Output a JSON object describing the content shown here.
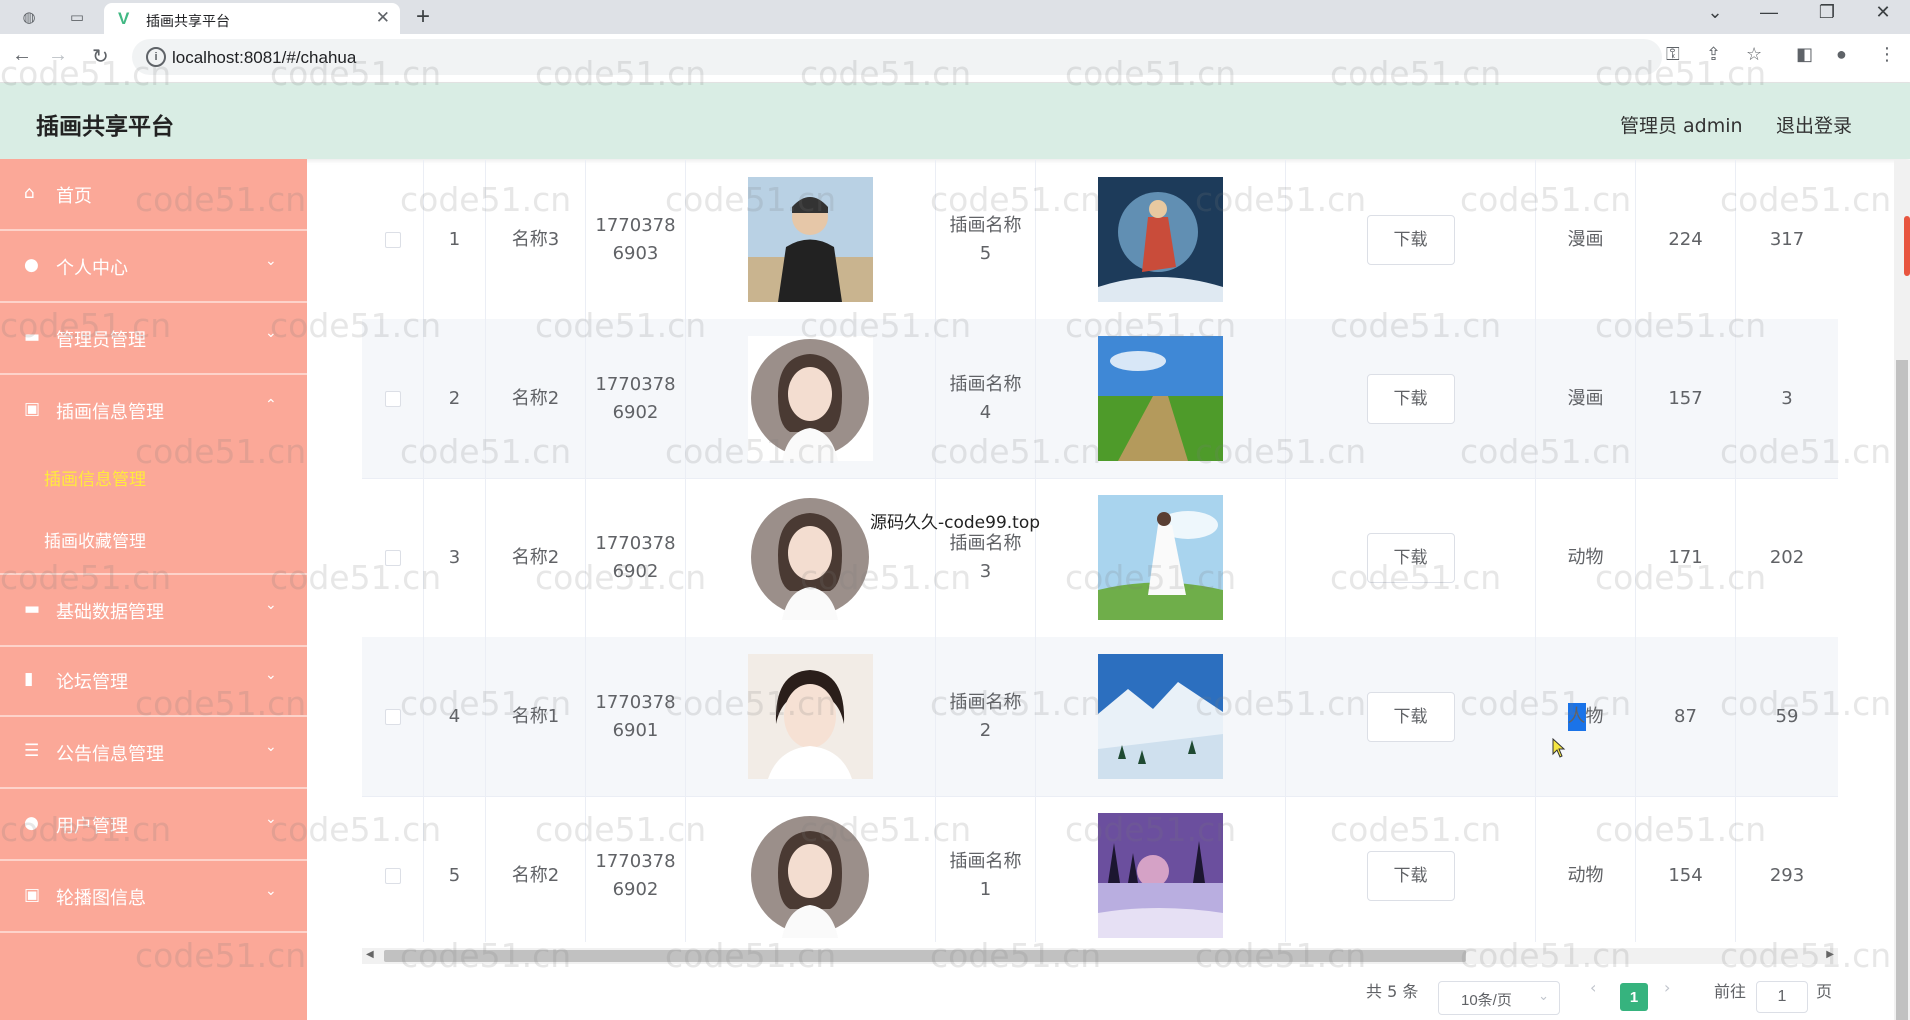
{
  "browser": {
    "tab_title": "插画共享平台",
    "url": "localhost:8081/#/chahua"
  },
  "header": {
    "title": "插画共享平台",
    "admin_label": "管理员 admin",
    "logout_label": "退出登录"
  },
  "sidebar": {
    "items": [
      {
        "label": "首页",
        "icon": "home-icon",
        "expanded": null
      },
      {
        "label": "个人中心",
        "icon": "user-icon",
        "expanded": false
      },
      {
        "label": "管理员管理",
        "icon": "folder-icon",
        "expanded": false
      },
      {
        "label": "插画信息管理",
        "icon": "clipboard-icon",
        "expanded": true
      },
      {
        "label": "基础数据管理",
        "icon": "folder-icon",
        "expanded": false
      },
      {
        "label": "论坛管理",
        "icon": "bar-chart-icon",
        "expanded": false
      },
      {
        "label": "公告信息管理",
        "icon": "list-icon",
        "expanded": false
      },
      {
        "label": "用户管理",
        "icon": "user-icon",
        "expanded": false
      },
      {
        "label": "轮播图信息",
        "icon": "clipboard-icon",
        "expanded": false
      }
    ],
    "sub_items": [
      {
        "label": "插画信息管理",
        "active": true
      },
      {
        "label": "插画收藏管理",
        "active": false
      }
    ]
  },
  "table": {
    "download_label": "下载",
    "rows": [
      {
        "index": "1",
        "name": "名称3",
        "phone": "1770378\n6903",
        "avatar": "portrait-jacket",
        "title": "插画名称\n5",
        "image": "action-figure",
        "category": "漫画",
        "col_a": "224",
        "col_b": "317"
      },
      {
        "index": "2",
        "name": "名称2",
        "phone": "1770378\n6902",
        "avatar": "illustrated-girl",
        "title": "插画名称\n4",
        "image": "grass-path",
        "category": "漫画",
        "col_a": "157",
        "col_b": "3"
      },
      {
        "index": "3",
        "name": "名称2",
        "phone": "1770378\n6902",
        "avatar": "illustrated-girl",
        "title": "插画名称\n3",
        "image": "woman-meadow",
        "category": "动物",
        "col_a": "171",
        "col_b": "202"
      },
      {
        "index": "4",
        "name": "名称1",
        "phone": "1770378\n6901",
        "avatar": "woman-portrait",
        "title": "插画名称\n2",
        "image": "snow-mountain",
        "category": "人物",
        "col_a": "87",
        "col_b": "59"
      },
      {
        "index": "5",
        "name": "名称2",
        "phone": "1770378\n6902",
        "avatar": "illustrated-girl",
        "title": "插画名称\n1",
        "image": "purple-lake",
        "category": "动物",
        "col_a": "154",
        "col_b": "293"
      }
    ]
  },
  "pagination": {
    "total": "共 5 条",
    "page_size": "10条/页",
    "current_page": "1",
    "goto_label": "前往",
    "goto_value": "1",
    "page_suffix": "页"
  },
  "overlay_text": "源码久久-code99.top",
  "watermark": "code51.cn",
  "colors": {
    "sidebar_bg": "#fba898",
    "header_bg": "#d9ede4",
    "active_submenu": "#ffeb3b",
    "page_active": "#36b37e"
  }
}
